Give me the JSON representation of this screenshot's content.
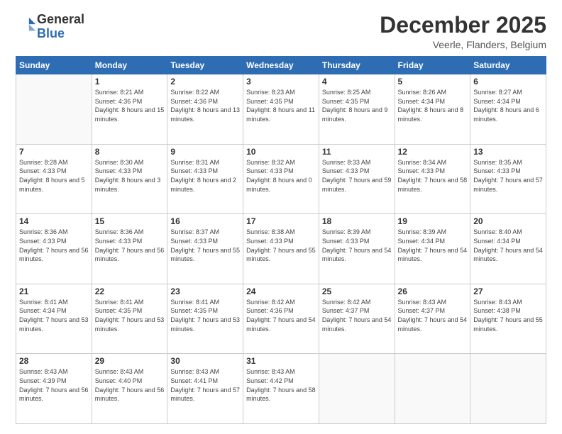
{
  "logo": {
    "line1": "General",
    "line2": "Blue"
  },
  "title": "December 2025",
  "location": "Veerle, Flanders, Belgium",
  "days_of_week": [
    "Sunday",
    "Monday",
    "Tuesday",
    "Wednesday",
    "Thursday",
    "Friday",
    "Saturday"
  ],
  "weeks": [
    [
      {
        "day": "",
        "sunrise": "",
        "sunset": "",
        "daylight": ""
      },
      {
        "day": "1",
        "sunrise": "Sunrise: 8:21 AM",
        "sunset": "Sunset: 4:36 PM",
        "daylight": "Daylight: 8 hours and 15 minutes."
      },
      {
        "day": "2",
        "sunrise": "Sunrise: 8:22 AM",
        "sunset": "Sunset: 4:36 PM",
        "daylight": "Daylight: 8 hours and 13 minutes."
      },
      {
        "day": "3",
        "sunrise": "Sunrise: 8:23 AM",
        "sunset": "Sunset: 4:35 PM",
        "daylight": "Daylight: 8 hours and 11 minutes."
      },
      {
        "day": "4",
        "sunrise": "Sunrise: 8:25 AM",
        "sunset": "Sunset: 4:35 PM",
        "daylight": "Daylight: 8 hours and 9 minutes."
      },
      {
        "day": "5",
        "sunrise": "Sunrise: 8:26 AM",
        "sunset": "Sunset: 4:34 PM",
        "daylight": "Daylight: 8 hours and 8 minutes."
      },
      {
        "day": "6",
        "sunrise": "Sunrise: 8:27 AM",
        "sunset": "Sunset: 4:34 PM",
        "daylight": "Daylight: 8 hours and 6 minutes."
      }
    ],
    [
      {
        "day": "7",
        "sunrise": "Sunrise: 8:28 AM",
        "sunset": "Sunset: 4:33 PM",
        "daylight": "Daylight: 8 hours and 5 minutes."
      },
      {
        "day": "8",
        "sunrise": "Sunrise: 8:30 AM",
        "sunset": "Sunset: 4:33 PM",
        "daylight": "Daylight: 8 hours and 3 minutes."
      },
      {
        "day": "9",
        "sunrise": "Sunrise: 8:31 AM",
        "sunset": "Sunset: 4:33 PM",
        "daylight": "Daylight: 8 hours and 2 minutes."
      },
      {
        "day": "10",
        "sunrise": "Sunrise: 8:32 AM",
        "sunset": "Sunset: 4:33 PM",
        "daylight": "Daylight: 8 hours and 0 minutes."
      },
      {
        "day": "11",
        "sunrise": "Sunrise: 8:33 AM",
        "sunset": "Sunset: 4:33 PM",
        "daylight": "Daylight: 7 hours and 59 minutes."
      },
      {
        "day": "12",
        "sunrise": "Sunrise: 8:34 AM",
        "sunset": "Sunset: 4:33 PM",
        "daylight": "Daylight: 7 hours and 58 minutes."
      },
      {
        "day": "13",
        "sunrise": "Sunrise: 8:35 AM",
        "sunset": "Sunset: 4:33 PM",
        "daylight": "Daylight: 7 hours and 57 minutes."
      }
    ],
    [
      {
        "day": "14",
        "sunrise": "Sunrise: 8:36 AM",
        "sunset": "Sunset: 4:33 PM",
        "daylight": "Daylight: 7 hours and 56 minutes."
      },
      {
        "day": "15",
        "sunrise": "Sunrise: 8:36 AM",
        "sunset": "Sunset: 4:33 PM",
        "daylight": "Daylight: 7 hours and 56 minutes."
      },
      {
        "day": "16",
        "sunrise": "Sunrise: 8:37 AM",
        "sunset": "Sunset: 4:33 PM",
        "daylight": "Daylight: 7 hours and 55 minutes."
      },
      {
        "day": "17",
        "sunrise": "Sunrise: 8:38 AM",
        "sunset": "Sunset: 4:33 PM",
        "daylight": "Daylight: 7 hours and 55 minutes."
      },
      {
        "day": "18",
        "sunrise": "Sunrise: 8:39 AM",
        "sunset": "Sunset: 4:33 PM",
        "daylight": "Daylight: 7 hours and 54 minutes."
      },
      {
        "day": "19",
        "sunrise": "Sunrise: 8:39 AM",
        "sunset": "Sunset: 4:34 PM",
        "daylight": "Daylight: 7 hours and 54 minutes."
      },
      {
        "day": "20",
        "sunrise": "Sunrise: 8:40 AM",
        "sunset": "Sunset: 4:34 PM",
        "daylight": "Daylight: 7 hours and 54 minutes."
      }
    ],
    [
      {
        "day": "21",
        "sunrise": "Sunrise: 8:41 AM",
        "sunset": "Sunset: 4:34 PM",
        "daylight": "Daylight: 7 hours and 53 minutes."
      },
      {
        "day": "22",
        "sunrise": "Sunrise: 8:41 AM",
        "sunset": "Sunset: 4:35 PM",
        "daylight": "Daylight: 7 hours and 53 minutes."
      },
      {
        "day": "23",
        "sunrise": "Sunrise: 8:41 AM",
        "sunset": "Sunset: 4:35 PM",
        "daylight": "Daylight: 7 hours and 53 minutes."
      },
      {
        "day": "24",
        "sunrise": "Sunrise: 8:42 AM",
        "sunset": "Sunset: 4:36 PM",
        "daylight": "Daylight: 7 hours and 54 minutes."
      },
      {
        "day": "25",
        "sunrise": "Sunrise: 8:42 AM",
        "sunset": "Sunset: 4:37 PM",
        "daylight": "Daylight: 7 hours and 54 minutes."
      },
      {
        "day": "26",
        "sunrise": "Sunrise: 8:43 AM",
        "sunset": "Sunset: 4:37 PM",
        "daylight": "Daylight: 7 hours and 54 minutes."
      },
      {
        "day": "27",
        "sunrise": "Sunrise: 8:43 AM",
        "sunset": "Sunset: 4:38 PM",
        "daylight": "Daylight: 7 hours and 55 minutes."
      }
    ],
    [
      {
        "day": "28",
        "sunrise": "Sunrise: 8:43 AM",
        "sunset": "Sunset: 4:39 PM",
        "daylight": "Daylight: 7 hours and 56 minutes."
      },
      {
        "day": "29",
        "sunrise": "Sunrise: 8:43 AM",
        "sunset": "Sunset: 4:40 PM",
        "daylight": "Daylight: 7 hours and 56 minutes."
      },
      {
        "day": "30",
        "sunrise": "Sunrise: 8:43 AM",
        "sunset": "Sunset: 4:41 PM",
        "daylight": "Daylight: 7 hours and 57 minutes."
      },
      {
        "day": "31",
        "sunrise": "Sunrise: 8:43 AM",
        "sunset": "Sunset: 4:42 PM",
        "daylight": "Daylight: 7 hours and 58 minutes."
      },
      {
        "day": "",
        "sunrise": "",
        "sunset": "",
        "daylight": ""
      },
      {
        "day": "",
        "sunrise": "",
        "sunset": "",
        "daylight": ""
      },
      {
        "day": "",
        "sunrise": "",
        "sunset": "",
        "daylight": ""
      }
    ]
  ]
}
